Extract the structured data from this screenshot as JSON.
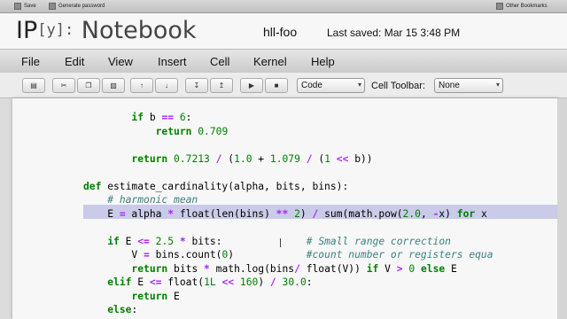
{
  "browser": {
    "bookmarks": [
      {
        "label": "Save",
        "icon": "save-icon"
      },
      {
        "label": "Generate password",
        "icon": "key-icon"
      }
    ],
    "other_bookmarks": "Other Bookmarks"
  },
  "header": {
    "logo_ip": "IP",
    "logo_y": "[y]:",
    "logo_notebook": "Notebook",
    "notebook_name": "hll-foo",
    "last_saved": "Last saved: Mar 15 3:48 PM"
  },
  "menu": [
    "File",
    "Edit",
    "View",
    "Insert",
    "Cell",
    "Kernel",
    "Help"
  ],
  "toolbar": {
    "cell_type": "Code",
    "cell_toolbar_label": "Cell Toolbar:",
    "cell_toolbar_value": "None",
    "icons": [
      "save-icon",
      "cut-icon",
      "copy-icon",
      "paste-icon",
      "move-up-icon",
      "move-down-icon",
      "insert-above-icon",
      "insert-below-icon",
      "run-icon",
      "stop-icon"
    ]
  },
  "code_lines": [
    "        if b == 6:",
    "            return 0.709",
    "",
    "        return 0.7213 / (1.0 + 1.079 / (1 << b))",
    "",
    "def estimate_cardinality(alpha, bits, bins):",
    "    # harmonic mean",
    "    E = alpha * float(len(bins) ** 2) / sum(math.pow(2.0, -x) for x",
    "",
    "    if E <= 2.5 * bits:              # Small range correction",
    "        V = bins.count(0)            #count number or registers equa",
    "        return bits * math.log(bins/ float(V)) if V > 0 else E",
    "    elif E <= float(1L << 160) / 30.0:",
    "        return E",
    "    else:"
  ]
}
